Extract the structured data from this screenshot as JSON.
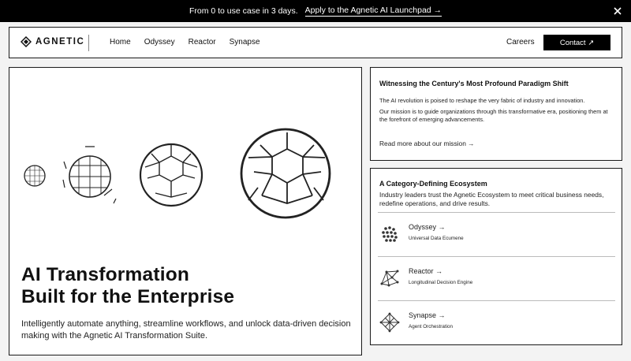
{
  "announcement": {
    "message": "From 0 to use case in 3 days.",
    "cta": "Apply to the Agnetic AI Launchpad →"
  },
  "nav": {
    "brand": "AGNETIC",
    "links": [
      "Home",
      "Odyssey",
      "Reactor",
      "Synapse"
    ],
    "careers": "Careers",
    "contact": "Contact ↗"
  },
  "hero": {
    "title_line1": "AI Transformation",
    "title_line2": "Built for the Enterprise",
    "subtitle": "Intelligently automate anything, streamline workflows, and unlock data-driven decision making with the Agnetic AI Transformation Suite."
  },
  "mission": {
    "title": "Witnessing the Century's Most Profound Paradigm Shift",
    "p1": "The AI revolution is poised to reshape the very fabric of industry and innovation.",
    "p2": "Our mission is to guide organizations through this transformative era, positioning them at the forefront of emerging advancements.",
    "read_more": "Read more about our mission →"
  },
  "ecosystem": {
    "title": "A Category-Defining Ecosystem",
    "lead": "Industry leaders trust the Agnetic Ecosystem to meet critical business needs, redefine operations, and drive results.",
    "products": [
      {
        "name": "Odyssey →",
        "desc": "Universal Data Ecumene",
        "icon": "dot-cluster-icon"
      },
      {
        "name": "Reactor →",
        "desc": "Longitudinal Decision Engine",
        "icon": "network-web-icon"
      },
      {
        "name": "Synapse →",
        "desc": "Agent Orchestration",
        "icon": "crystal-lattice-icon"
      }
    ]
  }
}
